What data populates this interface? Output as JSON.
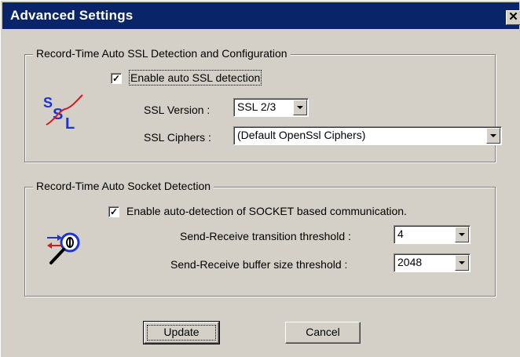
{
  "window": {
    "title": "Advanced Settings",
    "close_glyph": "✕"
  },
  "ssl_group": {
    "label": "Record-Time Auto SSL Detection and Configuration",
    "enable_checkbox_label": "Enable auto SSL detection",
    "enable_checked": true,
    "icon": "ssl-icon",
    "version_label": "SSL Version :",
    "version_value": "SSL 2/3",
    "ciphers_label": "SSL Ciphers :",
    "ciphers_value": "(Default OpenSsl Ciphers)"
  },
  "socket_group": {
    "label": "Record-Time Auto Socket Detection",
    "enable_checkbox_label": "Enable auto-detection of SOCKET based communication.",
    "enable_checked": true,
    "icon": "socket-detection-icon",
    "transition_label": "Send-Receive transition threshold :",
    "transition_value": "4",
    "buffer_label": "Send-Receive buffer size threshold :",
    "buffer_value": "2048"
  },
  "buttons": {
    "update": "Update",
    "cancel": "Cancel"
  },
  "colors": {
    "title_bar": "#0a246a",
    "face": "#d4d0c8"
  }
}
